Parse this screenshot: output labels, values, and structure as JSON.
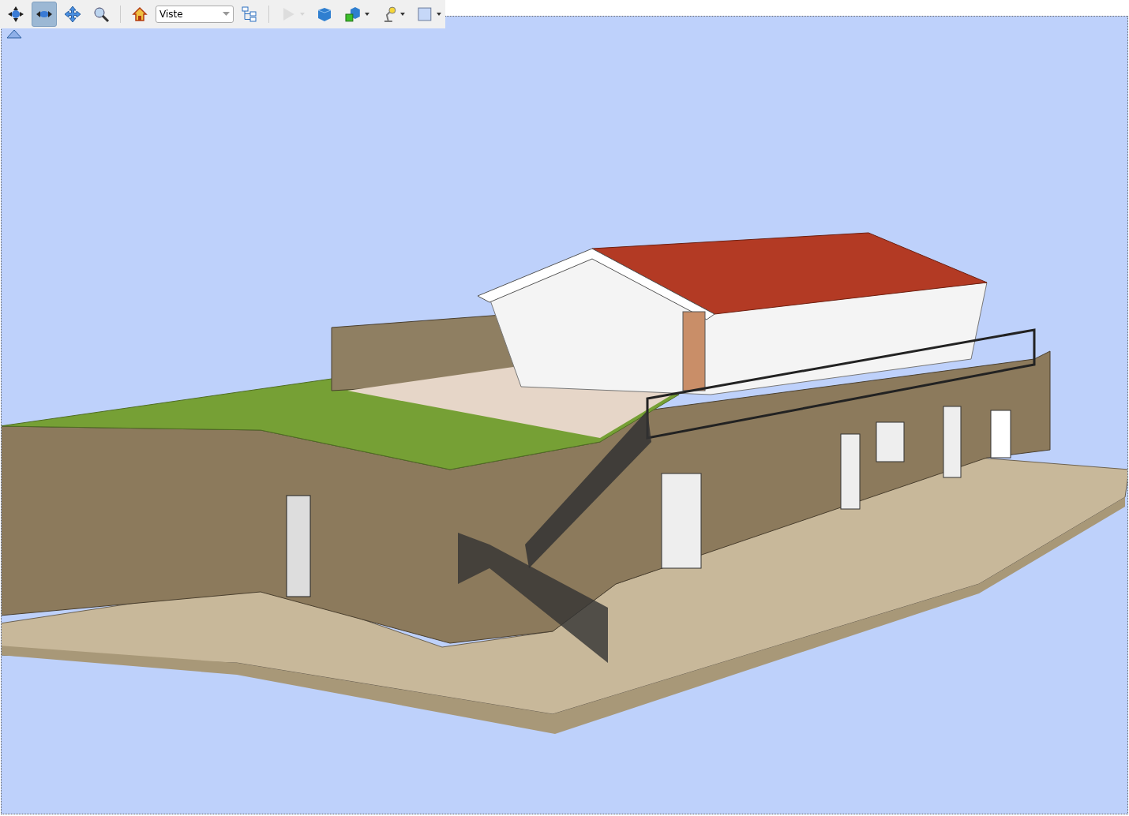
{
  "toolbar": {
    "tools": [
      {
        "kind": "button",
        "selected": false,
        "disabled": false
      },
      {
        "kind": "button",
        "selected": true,
        "disabled": false
      },
      {
        "kind": "button",
        "selected": false,
        "disabled": false
      },
      {
        "kind": "button",
        "selected": false,
        "disabled": false
      },
      {
        "kind": "separator"
      },
      {
        "kind": "button",
        "selected": false,
        "disabled": false
      },
      {
        "kind": "dropdown",
        "value": "Viste"
      },
      {
        "kind": "button",
        "selected": false,
        "disabled": false
      },
      {
        "kind": "separator"
      },
      {
        "kind": "menu",
        "selected": false,
        "disabled": true
      },
      {
        "kind": "button",
        "selected": false,
        "disabled": false
      },
      {
        "kind": "menu",
        "selected": false,
        "disabled": false
      },
      {
        "kind": "menu",
        "selected": false,
        "disabled": false
      },
      {
        "kind": "menu",
        "selected": false,
        "disabled": false
      }
    ]
  }
}
